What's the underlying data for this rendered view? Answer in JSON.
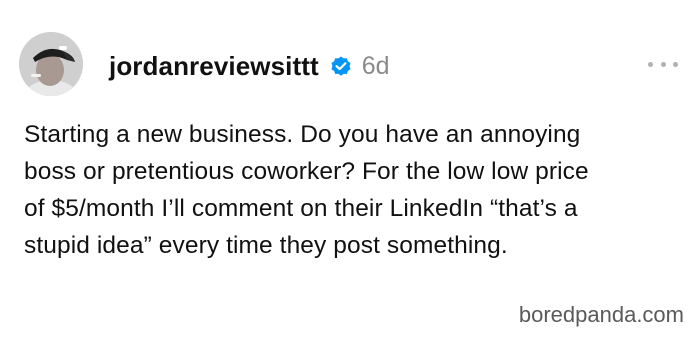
{
  "post": {
    "username": "jordanreviewsittt",
    "verified_icon": "verified-badge-icon",
    "time_ago": "6d",
    "more_icon": "more-options-icon",
    "body_lines": [
      "Starting a new business. Do you have an annoying",
      "boss or pretentious coworker? For the low low price",
      "of $5/month I’ll comment on their LinkedIn “that’s a",
      "stupid idea” every time they post something."
    ]
  },
  "watermark": {
    "text": "boredpanda.com"
  },
  "colors": {
    "verified_blue": "#0095f6",
    "time_gray": "#8a8a8a",
    "text": "#111111"
  }
}
